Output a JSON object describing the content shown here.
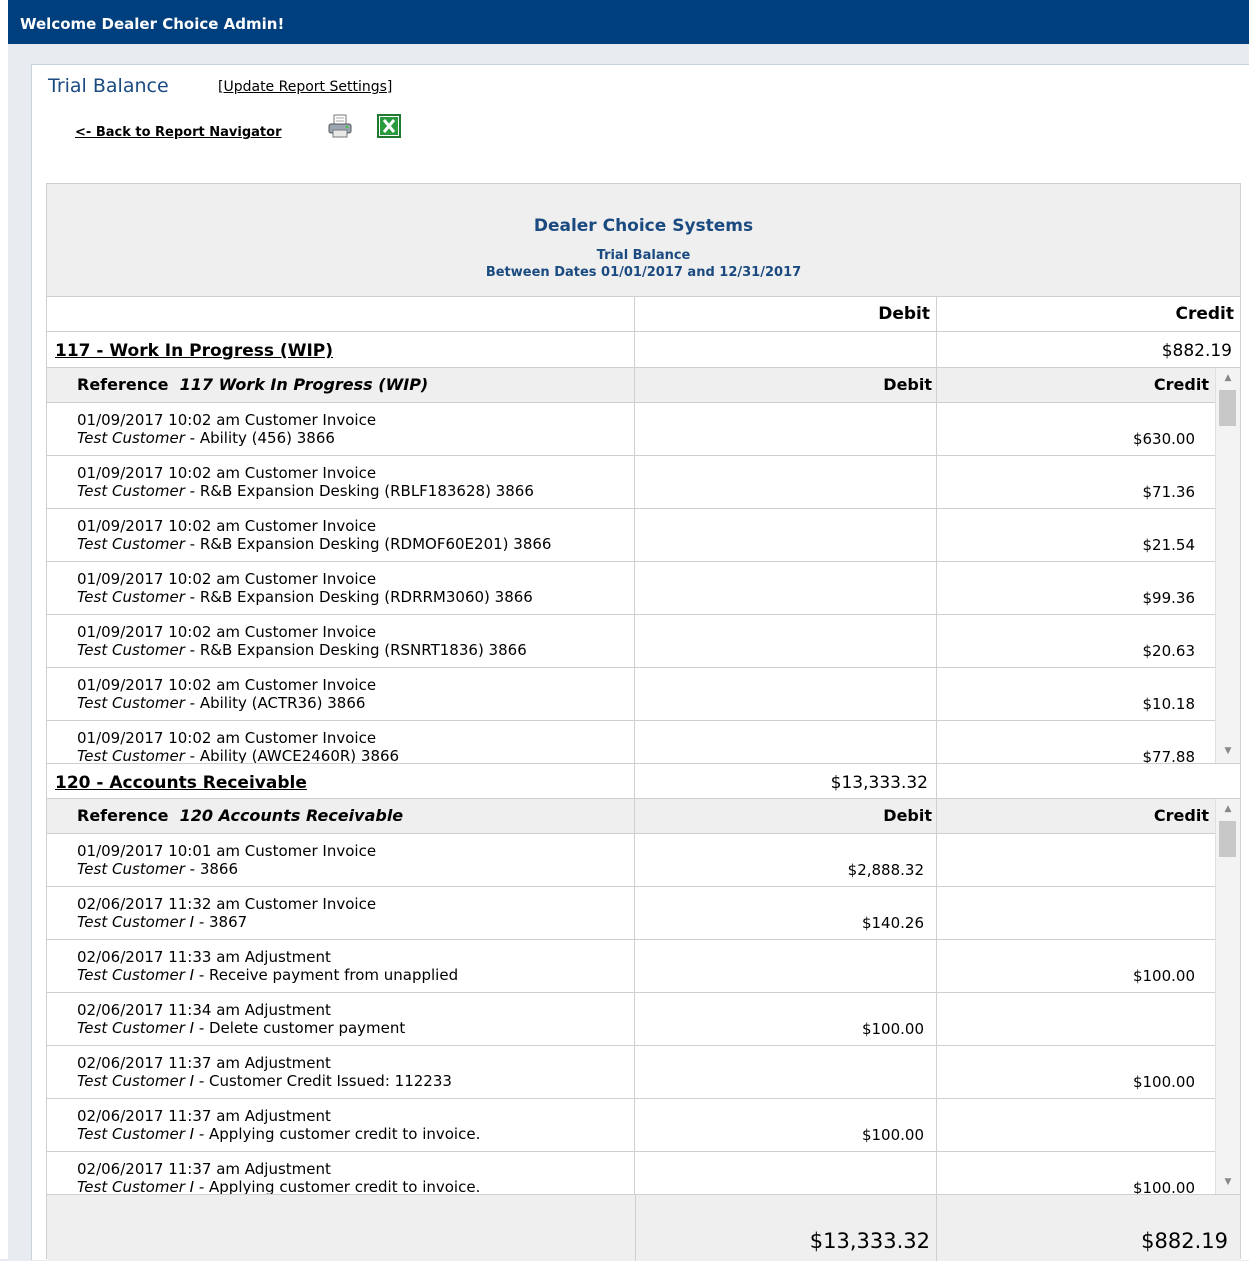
{
  "topbar": {
    "welcome": "Welcome Dealer Choice Admin!"
  },
  "page": {
    "title": "Trial Balance",
    "update_settings": "Update Report Settings",
    "back_link": "<- Back to Report Navigator",
    "print_icon": "printer-icon",
    "excel_icon": "excel-icon"
  },
  "report": {
    "company": "Dealer Choice Systems",
    "title": "Trial Balance",
    "dates": "Between Dates 01/01/2017 and 12/31/2017",
    "col_debit": "Debit",
    "col_credit": "Credit",
    "accounts": [
      {
        "name": "117 - Work In Progress (WIP)",
        "debit": "",
        "credit": "$882.19",
        "sub_ref_label": "Reference",
        "sub_ref_name": "117 Work In Progress (WIP)",
        "sub_debit": "Debit",
        "sub_credit": "Credit",
        "rows": [
          {
            "line1": "01/09/2017 10:02 am  Customer Invoice",
            "customer": "Test Customer",
            "desc": " - Ability (456) 3866",
            "debit": "",
            "credit": "$630.00"
          },
          {
            "line1": "01/09/2017 10:02 am  Customer Invoice",
            "customer": "Test Customer",
            "desc": " - R&B Expansion Desking (RBLF183628) 3866",
            "debit": "",
            "credit": "$71.36"
          },
          {
            "line1": "01/09/2017 10:02 am  Customer Invoice",
            "customer": "Test Customer",
            "desc": " - R&B Expansion Desking (RDMOF60E201) 3866",
            "debit": "",
            "credit": "$21.54"
          },
          {
            "line1": "01/09/2017 10:02 am  Customer Invoice",
            "customer": "Test Customer",
            "desc": " - R&B Expansion Desking (RDRRM3060) 3866",
            "debit": "",
            "credit": "$99.36"
          },
          {
            "line1": "01/09/2017 10:02 am  Customer Invoice",
            "customer": "Test Customer",
            "desc": " - R&B Expansion Desking (RSNRT1836) 3866",
            "debit": "",
            "credit": "$20.63"
          },
          {
            "line1": "01/09/2017 10:02 am  Customer Invoice",
            "customer": "Test Customer",
            "desc": " - Ability (ACTR36) 3866",
            "debit": "",
            "credit": "$10.18"
          },
          {
            "line1": "01/09/2017 10:02 am  Customer Invoice",
            "customer": "Test Customer",
            "desc": " - Ability (AWCE2460R) 3866",
            "debit": "",
            "credit": "$77.88"
          }
        ]
      },
      {
        "name": "120 - Accounts Receivable",
        "debit": "$13,333.32",
        "credit": "",
        "sub_ref_label": "Reference",
        "sub_ref_name": "120 Accounts Receivable",
        "sub_debit": "Debit",
        "sub_credit": "Credit",
        "rows": [
          {
            "line1": "01/09/2017 10:01 am  Customer Invoice",
            "customer": "Test Customer",
            "desc": " - 3866",
            "debit": "$2,888.32",
            "credit": ""
          },
          {
            "line1": "02/06/2017 11:32 am  Customer Invoice",
            "customer": "Test Customer I",
            "desc": " - 3867",
            "debit": "$140.26",
            "credit": ""
          },
          {
            "line1": "02/06/2017 11:33 am  Adjustment",
            "customer": "Test Customer I",
            "desc": " - Receive payment from unapplied",
            "debit": "",
            "credit": "$100.00"
          },
          {
            "line1": "02/06/2017 11:34 am  Adjustment",
            "customer": "Test Customer I",
            "desc": " - Delete customer payment",
            "debit": "$100.00",
            "credit": ""
          },
          {
            "line1": "02/06/2017 11:37 am  Adjustment",
            "customer": "Test Customer I",
            "desc": " - Customer Credit Issued: 112233",
            "debit": "",
            "credit": "$100.00"
          },
          {
            "line1": "02/06/2017 11:37 am  Adjustment",
            "customer": "Test Customer I",
            "desc": " - Applying customer credit to invoice.",
            "debit": "$100.00",
            "credit": ""
          },
          {
            "line1": "02/06/2017 11:37 am  Adjustment",
            "customer": "Test Customer I",
            "desc": " - Applying customer credit to invoice.",
            "debit": "",
            "credit": "$100.00"
          }
        ]
      }
    ],
    "total_debit": "$13,333.32",
    "total_credit": "$882.19"
  }
}
